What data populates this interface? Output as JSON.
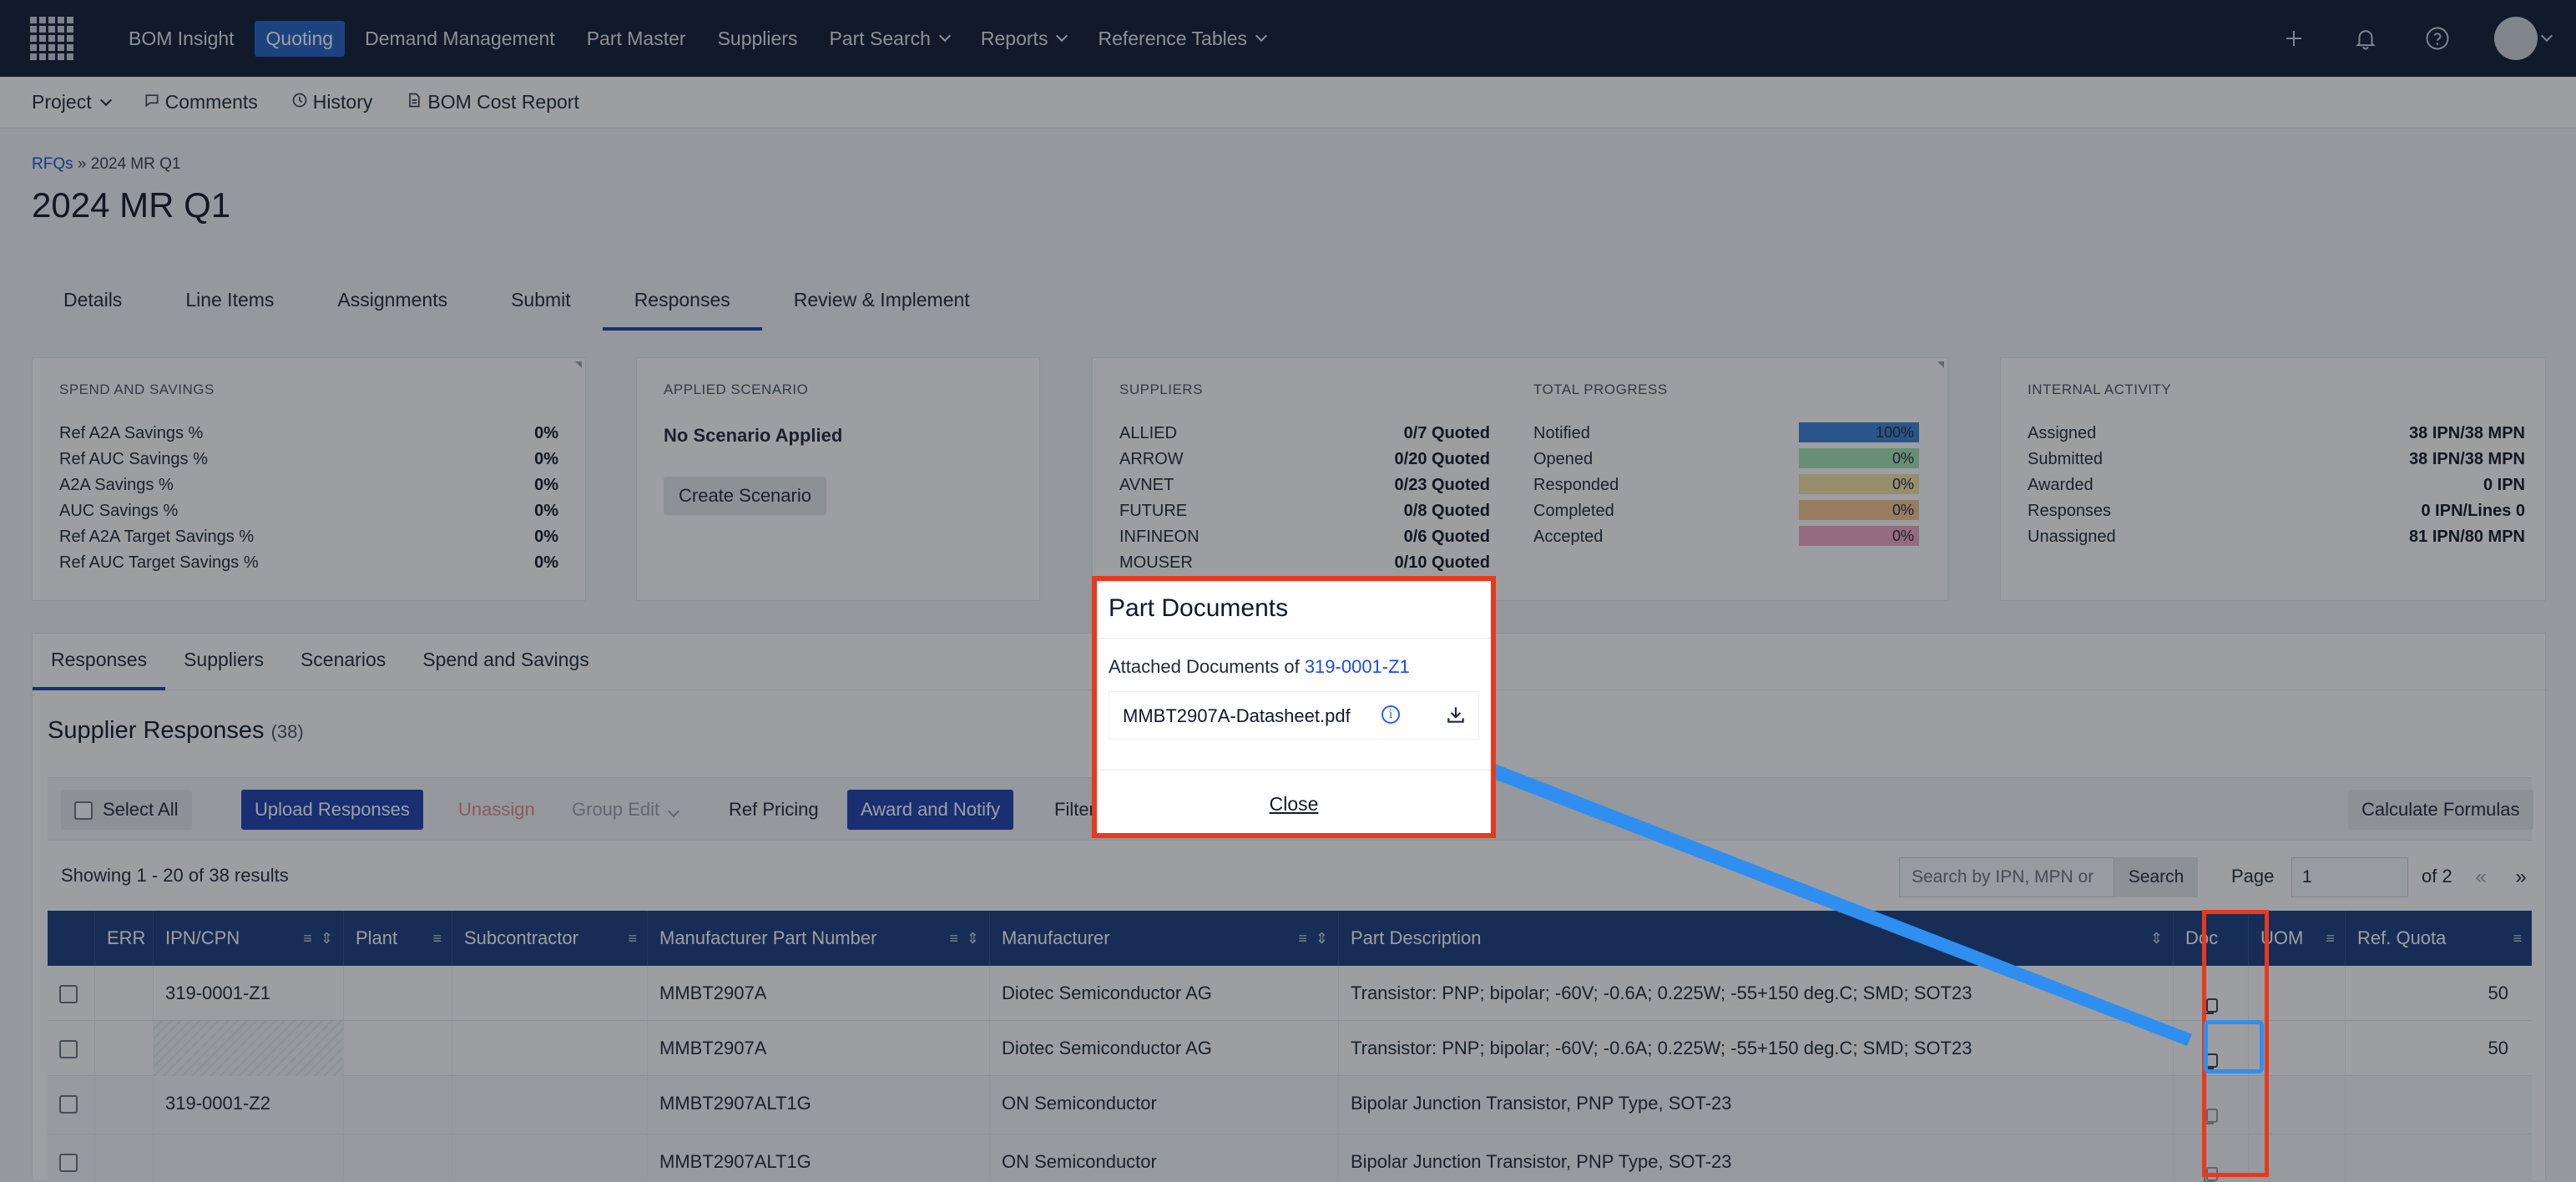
{
  "nav": {
    "items": [
      {
        "label": "BOM Insight",
        "active": false,
        "dropdown": false
      },
      {
        "label": "Quoting",
        "active": true,
        "dropdown": false
      },
      {
        "label": "Demand Management",
        "active": false,
        "dropdown": false
      },
      {
        "label": "Part Master",
        "active": false,
        "dropdown": false
      },
      {
        "label": "Suppliers",
        "active": false,
        "dropdown": false
      },
      {
        "label": "Part Search",
        "active": false,
        "dropdown": true
      },
      {
        "label": "Reports",
        "active": false,
        "dropdown": true
      },
      {
        "label": "Reference Tables",
        "active": false,
        "dropdown": true
      }
    ],
    "icons": [
      "plus-icon",
      "bell-icon",
      "help-icon",
      "avatar"
    ]
  },
  "subnav": {
    "project": "Project",
    "comments": "Comments",
    "history": "History",
    "bom_cost_report": "BOM Cost Report"
  },
  "breadcrumb": {
    "root": "RFQs",
    "sep": "»",
    "current": "2024 MR Q1"
  },
  "page_title": "2024 MR Q1",
  "tabs": [
    "Details",
    "Line Items",
    "Assignments",
    "Submit",
    "Responses",
    "Review & Implement"
  ],
  "active_tab": "Responses",
  "spend": {
    "header": "SPEND AND SAVINGS",
    "rows": [
      {
        "label": "Ref A2A Savings %",
        "value": "0%"
      },
      {
        "label": "Ref AUC Savings %",
        "value": "0%"
      },
      {
        "label": "A2A Savings %",
        "value": "0%"
      },
      {
        "label": "AUC Savings %",
        "value": "0%"
      },
      {
        "label": "Ref A2A Target Savings %",
        "value": "0%"
      },
      {
        "label": "Ref AUC Target Savings %",
        "value": "0%"
      }
    ]
  },
  "scenario": {
    "header": "APPLIED SCENARIO",
    "status": "No Scenario Applied",
    "button": "Create Scenario"
  },
  "suppliers": {
    "header": "SUPPLIERS",
    "rows": [
      {
        "label": "ALLIED",
        "value": "0/7 Quoted"
      },
      {
        "label": "ARROW",
        "value": "0/20 Quoted"
      },
      {
        "label": "AVNET",
        "value": "0/23 Quoted"
      },
      {
        "label": "FUTURE",
        "value": "0/8 Quoted"
      },
      {
        "label": "INFINEON",
        "value": "0/6 Quoted"
      },
      {
        "label": "MOUSER",
        "value": "0/10 Quoted"
      }
    ]
  },
  "progress": {
    "header": "TOTAL PROGRESS",
    "rows": [
      {
        "label": "Notified",
        "value": "100%",
        "fill": 1.0,
        "color": "#3b82d6"
      },
      {
        "label": "Opened",
        "value": "0%",
        "fill": 0.0,
        "color": "#a7e3b5"
      },
      {
        "label": "Responded",
        "value": "0%",
        "fill": 0.0,
        "color": "#f6e3a6"
      },
      {
        "label": "Completed",
        "value": "0%",
        "fill": 0.0,
        "color": "#f8c58f"
      },
      {
        "label": "Accepted",
        "value": "0%",
        "fill": 0.0,
        "color": "#f3a7c5"
      }
    ]
  },
  "activity": {
    "header": "INTERNAL ACTIVITY",
    "rows": [
      {
        "label": "Assigned",
        "value": "38 IPN/38 MPN"
      },
      {
        "label": "Submitted",
        "value": "38 IPN/38 MPN"
      },
      {
        "label": "Awarded",
        "value": "0 IPN"
      },
      {
        "label": "Responses",
        "value": "0 IPN/Lines 0"
      },
      {
        "label": "Unassigned",
        "value": "81 IPN/80 MPN"
      }
    ]
  },
  "lower_tabs": [
    "Responses",
    "Suppliers",
    "Scenarios",
    "Spend and Savings"
  ],
  "supplier_responses": {
    "title": "Supplier Responses",
    "count": "(38)"
  },
  "toolbar": {
    "select_all": "Select All",
    "upload": "Upload Responses",
    "unassign": "Unassign",
    "group_edit": "Group Edit",
    "ref_pricing": "Ref Pricing",
    "award": "Award and Notify",
    "filter": "Filter:",
    "calc": "Calculate Formulas"
  },
  "results": {
    "showing": "Showing 1 - 20 of 38 results",
    "search_placeholder": "Search by IPN, MPN or",
    "search_btn": "Search",
    "page_label": "Page",
    "page_value": "1",
    "page_of": "of 2",
    "prev": "«",
    "next": "»"
  },
  "columns": [
    "ERR",
    "IPN/CPN",
    "Plant",
    "Subcontractor",
    "Manufacturer Part Number",
    "Manufacturer",
    "Part Description",
    "Doc",
    "UOM",
    "Ref. Quota"
  ],
  "rows": [
    {
      "ipn": "319-0001-Z1",
      "mpn": "MMBT2907A",
      "mfr": "Diotec Semiconductor AG",
      "desc": "Transistor: PNP; bipolar; -60V; -0.6A; 0.225W; -55+150 deg.C; SMD; SOT23",
      "quota": "50"
    },
    {
      "ipn": "",
      "mpn": "MMBT2907A",
      "mfr": "Diotec Semiconductor AG",
      "desc": "Transistor: PNP; bipolar; -60V; -0.6A; 0.225W; -55+150 deg.C; SMD; SOT23",
      "quota": "50"
    },
    {
      "ipn": "319-0001-Z2",
      "mpn": "MMBT2907ALT1G",
      "mfr": "ON Semiconductor",
      "desc": "Bipolar Junction Transistor, PNP Type, SOT-23",
      "quota": ""
    },
    {
      "ipn": "",
      "mpn": "MMBT2907ALT1G",
      "mfr": "ON Semiconductor",
      "desc": "Bipolar Junction Transistor, PNP Type, SOT-23",
      "quota": ""
    }
  ],
  "modal": {
    "title": "Part Documents",
    "attached_prefix": "Attached Documents of",
    "attached_part": "319-0001-Z1",
    "doc_name": "MMBT2907A-Datasheet.pdf",
    "close": "Close"
  },
  "colors": {
    "nav_bg": "#0f1c33",
    "accent": "#1e40af",
    "highlight_red": "#e8391d",
    "highlight_blue": "#2e8ff0"
  }
}
